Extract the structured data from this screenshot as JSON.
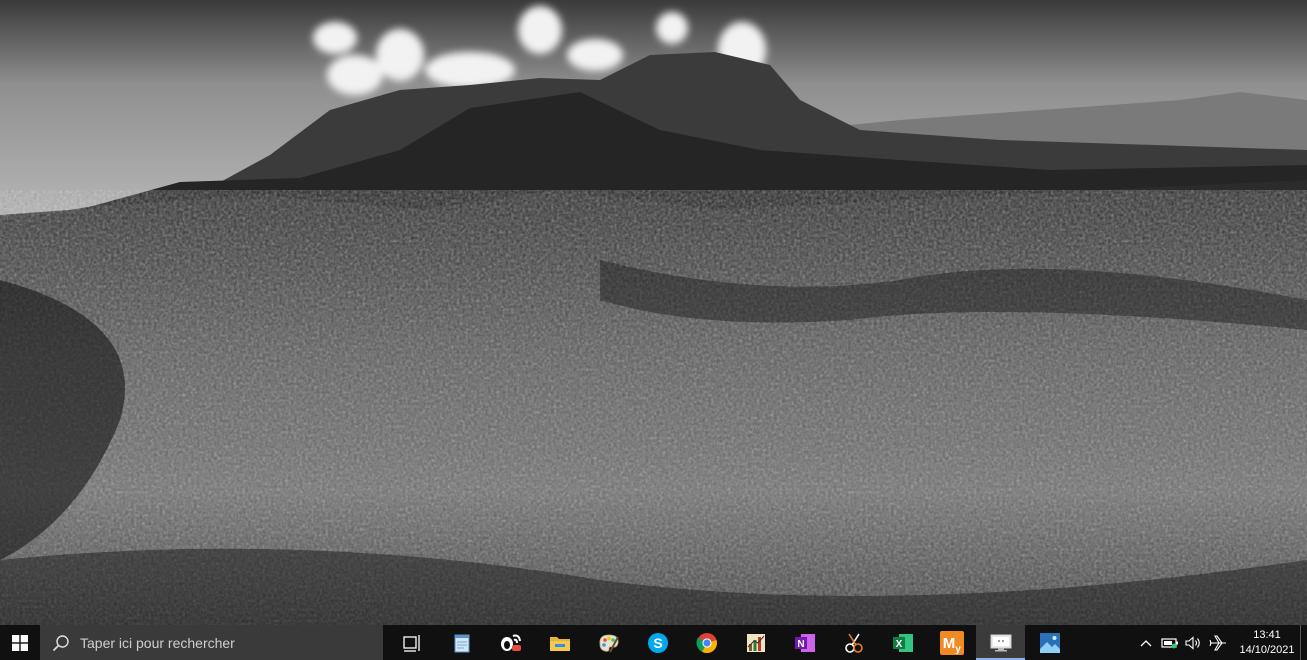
{
  "taskbar": {
    "start_icon": "windows-logo-icon",
    "search": {
      "placeholder": "Taper ici pour rechercher",
      "icon": "search-icon"
    },
    "apps": [
      {
        "icon": "task-view-icon"
      },
      {
        "icon": "notepad-icon"
      },
      {
        "icon": "chat-app-icon"
      },
      {
        "icon": "file-explorer-icon"
      },
      {
        "icon": "paint-icon"
      },
      {
        "icon": "skype-icon"
      },
      {
        "icon": "chrome-icon"
      },
      {
        "icon": "chart-app-icon"
      },
      {
        "icon": "onenote-icon"
      },
      {
        "icon": "snipping-tool-icon"
      },
      {
        "icon": "excel-icon"
      },
      {
        "icon": "my-app-icon"
      },
      {
        "icon": "remote-desktop-icon",
        "active": true
      },
      {
        "icon": "photos-icon"
      }
    ],
    "tray": {
      "icons": [
        "chevron-up-icon",
        "battery-icon",
        "volume-icon",
        "airplane-mode-icon"
      ],
      "time": "13:41",
      "date": "14/10/2021"
    }
  },
  "colors": {
    "taskbar_bg": "#101010",
    "search_bg": "#3a3a3a",
    "active_underline": "#8ab4e8"
  }
}
